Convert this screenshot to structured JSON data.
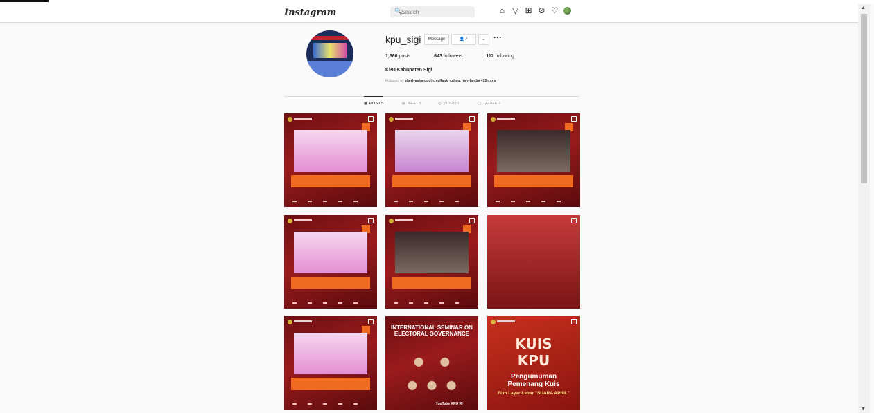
{
  "app": {
    "logo": "Instagram"
  },
  "search": {
    "placeholder": "Search",
    "glass": "🔍"
  },
  "nav_icons": [
    "home-icon",
    "direct-icon",
    "new-post-icon",
    "explore-icon",
    "activity-icon",
    "profile-avatar"
  ],
  "profile": {
    "username": "kpu_sigi",
    "message_label": "Message",
    "follow_label": "👤✓",
    "dropdown_label": "⌄",
    "more_label": "···",
    "posts_count": "1,360",
    "posts_label": "posts",
    "followers_count": "643",
    "followers_label": "followers",
    "following_count": "112",
    "following_label": "following",
    "full_name": "KPU Kabupaten Sigi",
    "followed_by_prefix": "Followed by",
    "followed_by_names": "sherlyasharuddin, sulfank_cahcu, nanylamba",
    "followed_by_more": "+13 more"
  },
  "tabs": [
    {
      "label": "POSTS",
      "icon": "▦"
    },
    {
      "label": "REELS",
      "icon": "▤"
    },
    {
      "label": "VIDEOS",
      "icon": "◎"
    },
    {
      "label": "TAGGED",
      "icon": "▢"
    }
  ],
  "posts": {
    "seminar_title": "INTERNATIONAL SEMINAR ON ELECTORAL GOVERNANCE",
    "seminar_youtube": "YouTube KPU RI",
    "kuis_title": "KUIS KPU",
    "kuis_heading": "Pengumuman Pemenang Kuis",
    "kuis_sub": "Film Layar Lebar \"SUARA APRIL\""
  },
  "colors": {
    "accent": "#f06a1f",
    "post_bg": "#8a1619"
  }
}
